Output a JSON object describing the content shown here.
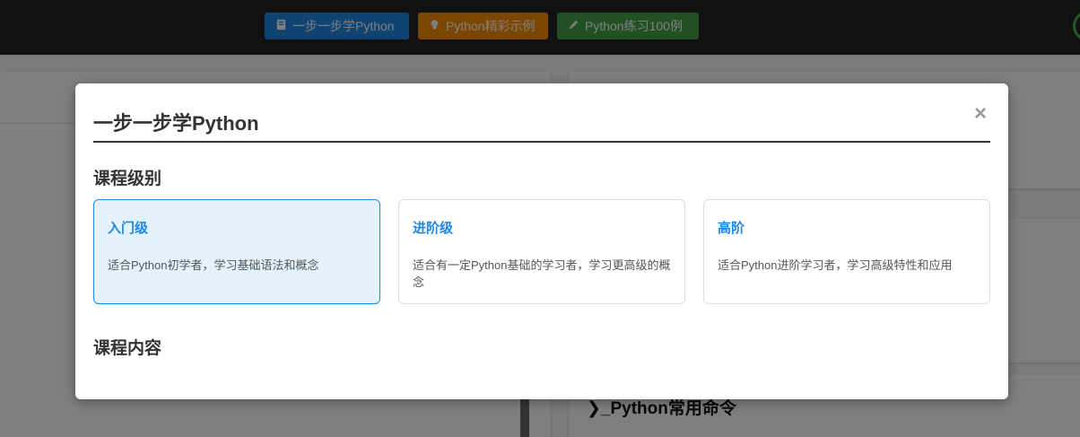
{
  "nav": {
    "buttons": [
      {
        "label": "一步一步学Python",
        "icon": "book-icon",
        "color": "#1e88e5"
      },
      {
        "label": "Python精彩示例",
        "icon": "lightbulb-icon",
        "color": "#fb8c00"
      },
      {
        "label": "Python练习100例",
        "icon": "pencil-icon",
        "color": "#43a047"
      }
    ]
  },
  "background": {
    "command_card_title": "❯_Python常用命令"
  },
  "modal": {
    "title": "一步一步学Python",
    "close_symbol": "×",
    "section_level": "课程级别",
    "section_content": "课程内容",
    "levels": [
      {
        "name": "入门级",
        "description": "适合Python初学者，学习基础语法和概念",
        "selected": true
      },
      {
        "name": "进阶级",
        "description": "适合有一定Python基础的学习者，学习更高级的概念",
        "selected": false
      },
      {
        "name": "高阶",
        "description": "适合Python进阶学习者，学习高级特性和应用",
        "selected": false
      }
    ]
  },
  "colors": {
    "accent": "#1e88e5",
    "selected_card_bg": "#e3f2fd"
  }
}
